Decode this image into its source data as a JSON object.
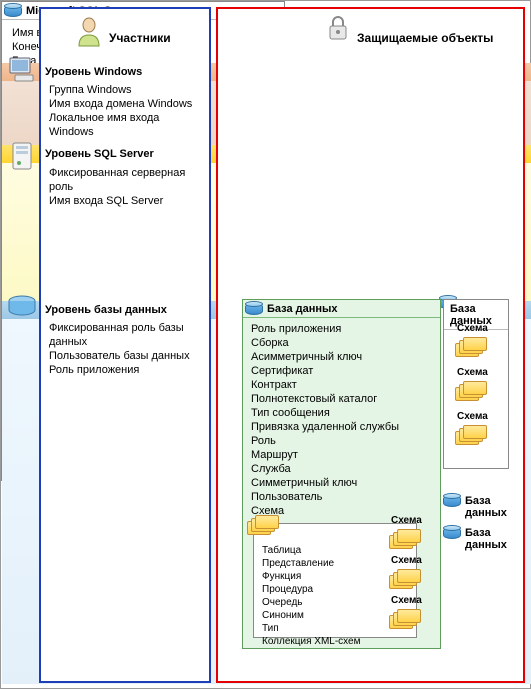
{
  "titles": {
    "left": "Участники",
    "right": "Защищаемые объекты"
  },
  "levels": {
    "windows": {
      "header": "Уровень Windows",
      "items": [
        "Группа Windows",
        "Имя входа домена Windows",
        "Локальное имя входа Windows"
      ]
    },
    "sqlserver": {
      "header": "Уровень SQL Server",
      "items": [
        "Фиксированная серверная роль",
        "Имя входа SQL Server"
      ]
    },
    "database": {
      "header": "Уровень базы данных",
      "items": [
        "Фиксированная роль базы данных",
        "Пользователь базы данных",
        "Роль приложения"
      ]
    }
  },
  "securables": {
    "server": {
      "title": "Microsoft SQL Server",
      "items": [
        "Имя входа SQL Server",
        "Конечная точка",
        "База данных"
      ]
    },
    "database_main": {
      "title": "База данных",
      "items": [
        "Роль приложения",
        "Сборка",
        "Асимметричный ключ",
        "Сертификат",
        "Контракт",
        "Полнотекстовый каталог",
        "Тип сообщения",
        "Привязка удаленной службы",
        "Роль",
        "Маршрут",
        "Служба",
        "Симметричный ключ",
        "Пользователь",
        "Схема"
      ]
    },
    "schema": {
      "title": "Схема",
      "items": [
        "Таблица",
        "Представление",
        "Функция",
        "Процедура",
        "Очередь",
        "Синоним",
        "Тип",
        "Коллекция XML-схем"
      ]
    },
    "database_side": {
      "title": "База данных",
      "schema_label": "Схема"
    },
    "extra_db_label": "База данных"
  },
  "icons": {
    "person": "person-icon",
    "lock": "lock-icon",
    "monitor": "monitor-icon",
    "server": "server-icon",
    "disk": "disk-icon",
    "database": "database-cylinder-icon",
    "schema_stack": "schema-stack-icon"
  }
}
